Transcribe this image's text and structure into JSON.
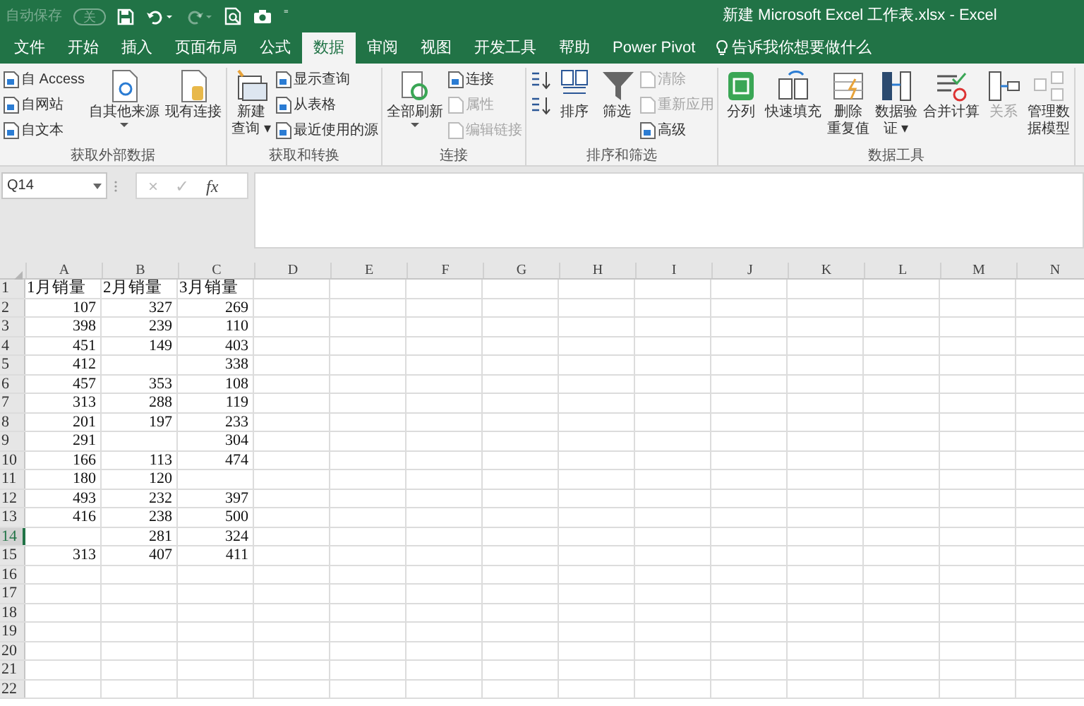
{
  "quick_access": {
    "autosave_label": "自动保存",
    "autosave_on": false,
    "autosave_state": "关",
    "customize": "⁼"
  },
  "window": {
    "title": "新建 Microsoft Excel 工作表.xlsx  -  Excel"
  },
  "tabs": [
    {
      "label": "文件",
      "selected": false
    },
    {
      "label": "开始",
      "selected": false
    },
    {
      "label": "插入",
      "selected": false
    },
    {
      "label": "页面布局",
      "selected": false
    },
    {
      "label": "公式",
      "selected": false
    },
    {
      "label": "数据",
      "selected": true
    },
    {
      "label": "审阅",
      "selected": false
    },
    {
      "label": "视图",
      "selected": false
    },
    {
      "label": "开发工具",
      "selected": false
    },
    {
      "label": "帮助",
      "selected": false
    },
    {
      "label": "Power Pivot",
      "selected": false
    }
  ],
  "tell_me": {
    "placeholder": "告诉我你想要做什么"
  },
  "ribbon": {
    "groups": [
      {
        "label": "获取外部数据",
        "items": [
          {
            "kind": "stack",
            "entries": [
              {
                "label": "自 Access",
                "disabled": false
              },
              {
                "label": "自网站",
                "disabled": false
              },
              {
                "label": "自文本",
                "disabled": false
              }
            ]
          },
          {
            "kind": "large",
            "lines": [
              "自其他来源"
            ],
            "caret": true,
            "disabled": false
          },
          {
            "kind": "large",
            "lines": [
              "现有连接"
            ],
            "caret": false,
            "disabled": false
          }
        ]
      },
      {
        "label": "获取和转换",
        "items": [
          {
            "kind": "large",
            "lines": [
              "新建",
              "查询 ▾"
            ],
            "caret": false,
            "disabled": false
          },
          {
            "kind": "stack",
            "entries": [
              {
                "label": "显示查询",
                "disabled": false
              },
              {
                "label": "从表格",
                "disabled": false
              },
              {
                "label": "最近使用的源",
                "disabled": false
              }
            ]
          }
        ]
      },
      {
        "label": "连接",
        "items": [
          {
            "kind": "large",
            "lines": [
              "全部刷新"
            ],
            "caret": true,
            "disabled": false
          },
          {
            "kind": "stack",
            "entries": [
              {
                "label": "连接",
                "disabled": false
              },
              {
                "label": "属性",
                "disabled": true
              },
              {
                "label": "编辑链接",
                "disabled": true
              }
            ]
          }
        ]
      },
      {
        "label": "排序和筛选",
        "items": [
          {
            "kind": "sort_icons"
          },
          {
            "kind": "large",
            "lines": [
              "排序"
            ],
            "caret": false,
            "disabled": false
          },
          {
            "kind": "large",
            "lines": [
              "筛选"
            ],
            "caret": false,
            "disabled": false
          },
          {
            "kind": "stack",
            "entries": [
              {
                "label": "清除",
                "disabled": true
              },
              {
                "label": "重新应用",
                "disabled": true
              },
              {
                "label": "高级",
                "disabled": false
              }
            ]
          }
        ]
      },
      {
        "label": "数据工具",
        "items": [
          {
            "kind": "large",
            "lines": [
              "分列"
            ],
            "caret": false,
            "disabled": false
          },
          {
            "kind": "large",
            "lines": [
              "快速填充"
            ],
            "caret": false,
            "disabled": false
          },
          {
            "kind": "large",
            "lines": [
              "删除",
              "重复值"
            ],
            "caret": false,
            "disabled": false
          },
          {
            "kind": "large",
            "lines": [
              "数据验",
              "证 ▾"
            ],
            "caret": false,
            "disabled": false
          },
          {
            "kind": "large",
            "lines": [
              "合并计算"
            ],
            "caret": false,
            "disabled": false
          },
          {
            "kind": "large",
            "lines": [
              "关系"
            ],
            "caret": false,
            "disabled": true
          },
          {
            "kind": "large",
            "lines": [
              "管理数",
              "据模型"
            ],
            "caret": false,
            "disabled": false
          }
        ]
      }
    ]
  },
  "formula_bar": {
    "name_box": "Q14",
    "cancel": "×",
    "enter": "✓",
    "function": "fx"
  },
  "columns": [
    {
      "label": "A",
      "selected": false
    },
    {
      "label": "B",
      "selected": false
    },
    {
      "label": "C",
      "selected": false
    },
    {
      "label": "D",
      "selected": false
    },
    {
      "label": "E",
      "selected": false
    },
    {
      "label": "F",
      "selected": false
    },
    {
      "label": "G",
      "selected": false
    },
    {
      "label": "H",
      "selected": false
    },
    {
      "label": "I",
      "selected": false
    },
    {
      "label": "J",
      "selected": false
    },
    {
      "label": "K",
      "selected": false
    },
    {
      "label": "L",
      "selected": false
    },
    {
      "label": "M",
      "selected": false
    },
    {
      "label": "N",
      "selected": false
    }
  ],
  "rows": [
    {
      "label": "1",
      "selected": false,
      "kind": "header",
      "cells": [
        "1月销量",
        "2月销量",
        "3月销量"
      ]
    },
    {
      "label": "2",
      "selected": false,
      "kind": "data",
      "cells": [
        "107",
        "327",
        "269"
      ]
    },
    {
      "label": "3",
      "selected": false,
      "kind": "data",
      "cells": [
        "398",
        "239",
        "110"
      ]
    },
    {
      "label": "4",
      "selected": false,
      "kind": "data",
      "cells": [
        "451",
        "149",
        "403"
      ]
    },
    {
      "label": "5",
      "selected": false,
      "kind": "data",
      "cells": [
        "412",
        null,
        "338"
      ]
    },
    {
      "label": "6",
      "selected": false,
      "kind": "data",
      "cells": [
        "457",
        "353",
        "108"
      ]
    },
    {
      "label": "7",
      "selected": false,
      "kind": "data",
      "cells": [
        "313",
        "288",
        "119"
      ]
    },
    {
      "label": "8",
      "selected": false,
      "kind": "data",
      "cells": [
        "201",
        "197",
        "233"
      ]
    },
    {
      "label": "9",
      "selected": false,
      "kind": "data",
      "cells": [
        "291",
        null,
        "304"
      ]
    },
    {
      "label": "10",
      "selected": false,
      "kind": "data",
      "cells": [
        "166",
        "113",
        "474"
      ]
    },
    {
      "label": "11",
      "selected": false,
      "kind": "data",
      "cells": [
        "180",
        "120",
        null
      ]
    },
    {
      "label": "12",
      "selected": false,
      "kind": "data",
      "cells": [
        "493",
        "232",
        "397"
      ]
    },
    {
      "label": "13",
      "selected": false,
      "kind": "data",
      "cells": [
        "416",
        "238",
        "500"
      ]
    },
    {
      "label": "14",
      "selected": true,
      "kind": "data",
      "cells": [
        null,
        "281",
        "324"
      ]
    },
    {
      "label": "15",
      "selected": false,
      "kind": "data",
      "cells": [
        "313",
        "407",
        "411"
      ]
    },
    {
      "label": "16",
      "selected": false,
      "kind": "data",
      "cells": []
    },
    {
      "label": "17",
      "selected": false,
      "kind": "data",
      "cells": []
    },
    {
      "label": "18",
      "selected": false,
      "kind": "data",
      "cells": []
    },
    {
      "label": "19",
      "selected": false,
      "kind": "data",
      "cells": []
    },
    {
      "label": "20",
      "selected": false,
      "kind": "data",
      "cells": []
    },
    {
      "label": "21",
      "selected": false,
      "kind": "data",
      "cells": []
    },
    {
      "label": "22",
      "selected": false,
      "kind": "data",
      "cells": []
    }
  ]
}
